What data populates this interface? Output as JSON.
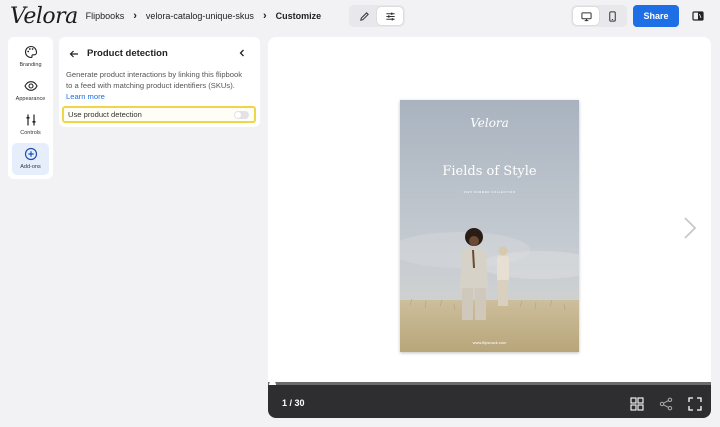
{
  "topbar": {
    "logo": "Velora",
    "breadcrumbs": [
      "Flipbooks",
      "velora-catalog-unique-skus",
      "Customize"
    ],
    "share_label": "Share",
    "icons": [
      "pencil-icon",
      "sliders-icon",
      "desktop-icon",
      "mobile-icon",
      "contrast-icon"
    ]
  },
  "rail": {
    "items": [
      {
        "label": "Branding",
        "icon": "palette-icon"
      },
      {
        "label": "Appearance",
        "icon": "eye-icon"
      },
      {
        "label": "Controls",
        "icon": "sliders-icon"
      },
      {
        "label": "Add-ons",
        "icon": "plus-circle-icon"
      }
    ]
  },
  "panel": {
    "title": "Product detection",
    "description": "Generate product interactions by linking this flipbook to a feed with matching product identifiers (SKUs).",
    "learn_more": "Learn more",
    "toggle_label": "Use product detection",
    "toggle_on": false
  },
  "preview": {
    "cover_logo": "Velora",
    "cover_title": "Fields of Style",
    "cover_subtitle": "2025 SUMMER COLLECTION",
    "cover_url": "www.flipsnack.com",
    "page_indicator": "1 / 30",
    "progress": 0.0
  },
  "colors": {
    "accent": "#1e6fe6",
    "highlight": "#f0d54a",
    "control_bar": "#2e2e30"
  }
}
